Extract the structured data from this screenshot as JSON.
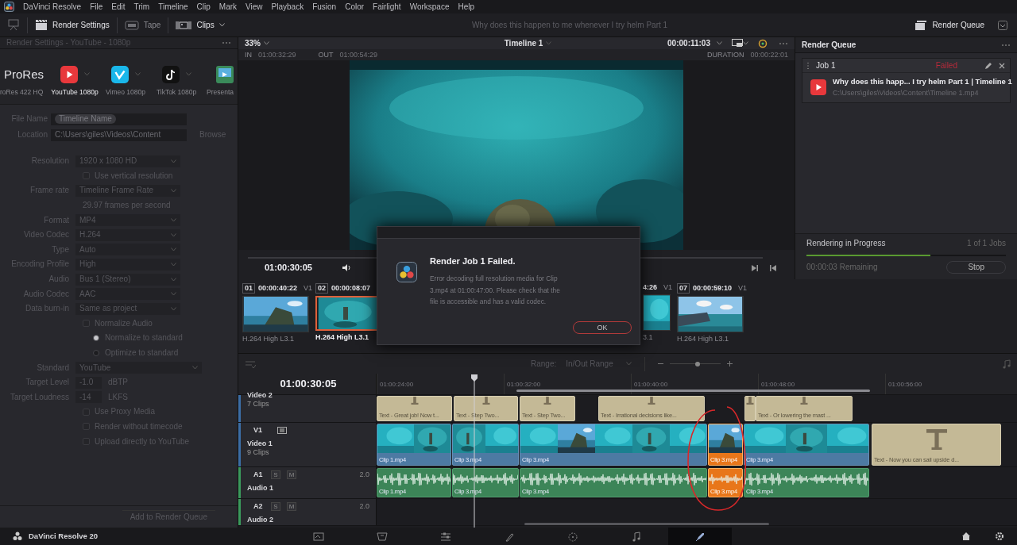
{
  "app": {
    "name": "DaVinci Resolve",
    "menus": [
      "File",
      "Edit",
      "Trim",
      "Timeline",
      "Clip",
      "Mark",
      "View",
      "Playback",
      "Fusion",
      "Color",
      "Fairlight",
      "Workspace",
      "Help"
    ]
  },
  "toolbar": {
    "items": [
      {
        "kind": "monitor",
        "selected": false
      },
      {
        "kind": "render",
        "label": "Render Settings",
        "selected": true
      },
      {
        "kind": "tape",
        "label": "Tape",
        "selected": false
      },
      {
        "kind": "clips",
        "label": "Clips",
        "selected": true,
        "dropdown": true
      }
    ],
    "project_title": "Why does this happen to me whenever I try helm Part 1",
    "queue_button": "Render Queue"
  },
  "render_settings": {
    "title": "Render Settings - YouTube - 1080p",
    "disabled": true,
    "presets": [
      {
        "kind": "prores",
        "name": "ProRes",
        "label": "roRes 422 HQ",
        "selected": false
      },
      {
        "kind": "youtube",
        "label": "YouTube 1080p",
        "selected": true
      },
      {
        "kind": "vimeo",
        "label": "Vimeo 1080p",
        "selected": false
      },
      {
        "kind": "tiktok",
        "label": "TikTok 1080p",
        "selected": false
      },
      {
        "kind": "presentation",
        "label": "Presenta",
        "selected": false
      }
    ],
    "file_name": {
      "label": "File Name",
      "value": "Timeline Name"
    },
    "location": {
      "label": "Location",
      "value": "C:\\Users\\giles\\Videos\\Content",
      "button": "Browse"
    },
    "rows": [
      {
        "kind": "select",
        "label": "Resolution",
        "value": "1920 x 1080 HD"
      },
      {
        "kind": "checkbox",
        "label": "Use vertical resolution",
        "checked": false
      },
      {
        "kind": "select",
        "label": "Frame rate",
        "value": "Timeline Frame Rate"
      },
      {
        "kind": "note",
        "text": "29.97 frames per second"
      },
      {
        "kind": "select",
        "label": "Format",
        "value": "MP4"
      },
      {
        "kind": "select",
        "label": "Video Codec",
        "value": "H.264"
      },
      {
        "kind": "select",
        "label": "Type",
        "value": "Auto"
      },
      {
        "kind": "select",
        "label": "Encoding Profile",
        "value": "High"
      },
      {
        "kind": "select",
        "label": "Audio",
        "value": "Bus 1 (Stereo)"
      },
      {
        "kind": "select",
        "label": "Audio Codec",
        "value": "AAC"
      },
      {
        "kind": "select",
        "label": "Data burn-in",
        "value": "Same as project"
      },
      {
        "kind": "checkbox",
        "label": "Normalize Audio",
        "checked": false
      },
      {
        "kind": "radio",
        "label": "Normalize to standard",
        "selected": true
      },
      {
        "kind": "radio",
        "label": "Optimize to standard",
        "selected": false
      },
      {
        "kind": "select",
        "label": "Standard",
        "value": "YouTube"
      },
      {
        "kind": "number",
        "label": "Target Level",
        "value": "-1.0",
        "unit": "dBTP"
      },
      {
        "kind": "number",
        "label": "Target Loudness",
        "value": "-14",
        "unit": "LKFS"
      },
      {
        "kind": "checkbox",
        "label": "Use Proxy Media",
        "checked": false
      },
      {
        "kind": "checkbox",
        "label": "Render without timecode",
        "checked": false
      },
      {
        "kind": "checkbox",
        "label": "Upload directly to YouTube",
        "checked": false
      }
    ],
    "add_button": "Add to Render Queue"
  },
  "viewer": {
    "zoom": "33%",
    "timeline": "Timeline 1",
    "timecode": "00:00:11:03",
    "marks": [
      {
        "label": "IN",
        "value": "01:00:32:29"
      },
      {
        "label": "OUT",
        "value": "01:00:54:29"
      },
      {
        "label": "DURATION",
        "value": "00:00:22:01"
      }
    ],
    "playhead_timecode": "01:00:30:05"
  },
  "render_queue": {
    "title": "Render Queue",
    "jobs": [
      {
        "name": "Job 1",
        "status": "Failed",
        "failed": true,
        "title": "Why does this happ... I try helm Part 1 | Timeline 1",
        "path": "C:\\Users\\giles\\Videos\\Content\\Timeline 1.mp4"
      }
    ],
    "progress": {
      "label": "Rendering in Progress",
      "count": "1 of 1 Jobs",
      "level": 0.62,
      "remaining": "00:00:03 Remaining",
      "button": "Stop"
    }
  },
  "clip_strip": [
    {
      "kind": "full",
      "number": "01",
      "timecode": "00:00:40:22",
      "track": "V1",
      "codec": "H.264 High L3.1",
      "selected": false
    },
    {
      "kind": "full",
      "number": "02",
      "timecode": "00:00:08:07",
      "codec": "H.264 High L3.1",
      "selected": true
    },
    {
      "kind": "cut",
      "timecode": "4:26",
      "track": "V1",
      "codec": "3.1",
      "selected": false
    },
    {
      "kind": "full",
      "number": "07",
      "timecode": "00:00:59:10",
      "track": "V1",
      "codec": "H.264 High L3.1",
      "selected": false
    }
  ],
  "dialog": {
    "title": "Render Job 1 Failed.",
    "message": "Error decoding full resolution media for Clip 3.mp4 at 01:00:47:00. Please check that the file is accessible and has a valid codec.",
    "button": "OK"
  },
  "timeline": {
    "range_label": "Range:",
    "range_value": "In/Out Range",
    "zoom": {
      "level": 0.55
    },
    "timecode": "01:00:30:05",
    "ruler": [
      "01:00:24:00",
      "01:00:32:00",
      "01:00:40:00",
      "01:00:48:00",
      "01:00:56:00"
    ],
    "tracks": [
      {
        "kind": "video",
        "name": "Video 2",
        "count": "7 Clips",
        "clips": [
          {
            "kind": "text",
            "label": "Text - Great job! Now t...",
            "selected": false
          },
          {
            "kind": "text",
            "label": "Text - Step Two...",
            "selected": false
          },
          {
            "kind": "text",
            "label": "Text - Step Two...",
            "selected": false
          },
          {
            "kind": "text",
            "label": "Text - Irrational decisions like...",
            "selected": false
          },
          {
            "kind": "text",
            "selected": false
          },
          {
            "kind": "text",
            "label": "Text - Or lowering the mast ...",
            "selected": false
          }
        ]
      },
      {
        "kind": "video",
        "code": "V1",
        "name": "Video 1",
        "count": "9 Clips",
        "clips": [
          {
            "kind": "video",
            "label": "Clip 1.mp4",
            "selected": false
          },
          {
            "kind": "video",
            "label": "Clip 3.mp4",
            "selected": false
          },
          {
            "kind": "video",
            "label": "Clip 3.mp4",
            "selected": false
          },
          {
            "kind": "video",
            "label": "Clip 3.mp4",
            "selected": true
          },
          {
            "kind": "video",
            "label": "Clip 3.mp4",
            "selected": false
          },
          {
            "kind": "text",
            "label": "Text - Now you can sail upside d...",
            "selected": false
          }
        ]
      },
      {
        "kind": "audio",
        "code": "A1",
        "solo": "S",
        "mute": "M",
        "channels": "2.0",
        "name": "Audio 1",
        "clips": [
          {
            "kind": "audio",
            "label": "Clip 1.mp4",
            "selected": false
          },
          {
            "kind": "audio",
            "label": "Clip 3.mp4",
            "selected": false
          },
          {
            "kind": "audio",
            "label": "Clip 3.mp4",
            "selected": false
          },
          {
            "kind": "audio",
            "label": "Clip 3.mp4",
            "selected": true
          },
          {
            "kind": "audio",
            "label": "Clip 3.mp4",
            "selected": false
          }
        ]
      },
      {
        "kind": "audio",
        "code": "A2",
        "solo": "S",
        "mute": "M",
        "channels": "2.0",
        "name": "Audio 2"
      }
    ]
  },
  "page_bar": {
    "app_label": "DaVinci Resolve 20",
    "pages": [
      {
        "kind": "media",
        "selected": false
      },
      {
        "kind": "cut",
        "selected": false
      },
      {
        "kind": "edit",
        "selected": false
      },
      {
        "kind": "fusion",
        "selected": false
      },
      {
        "kind": "color",
        "selected": false
      },
      {
        "kind": "fairlight",
        "selected": false
      },
      {
        "kind": "deliver",
        "selected": true
      }
    ]
  }
}
